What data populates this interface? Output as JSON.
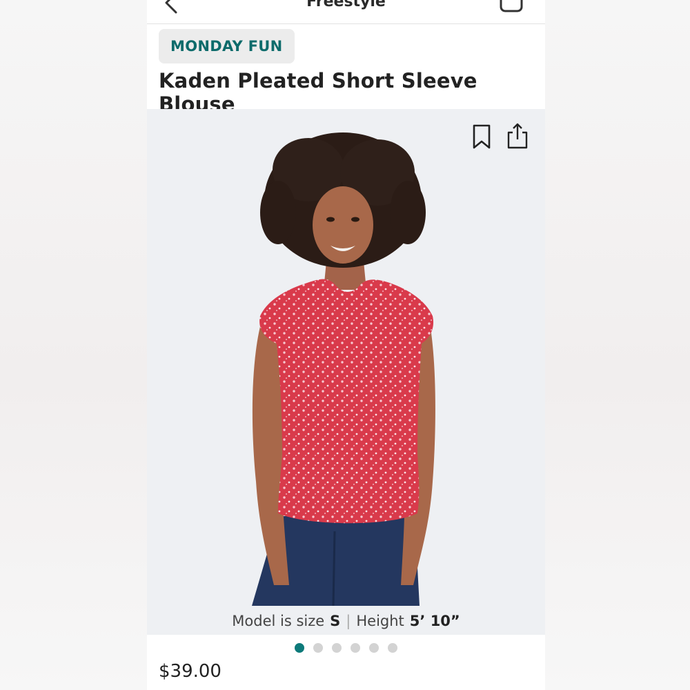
{
  "header": {
    "title": "Freestyle"
  },
  "collection_badge": "MONDAY FUN",
  "product": {
    "title": "Kaden Pleated Short Sleeve Blouse",
    "price": "$39.00"
  },
  "model_info": {
    "size_label": "Model is size",
    "size": "S",
    "height_label": "Height",
    "height": "5’ 10”"
  },
  "gallery": {
    "total_images": 6,
    "active_index": 0
  },
  "colors": {
    "accent": "#0d7a7a",
    "blouse": "#d93a4b",
    "jeans": "#24375f"
  }
}
